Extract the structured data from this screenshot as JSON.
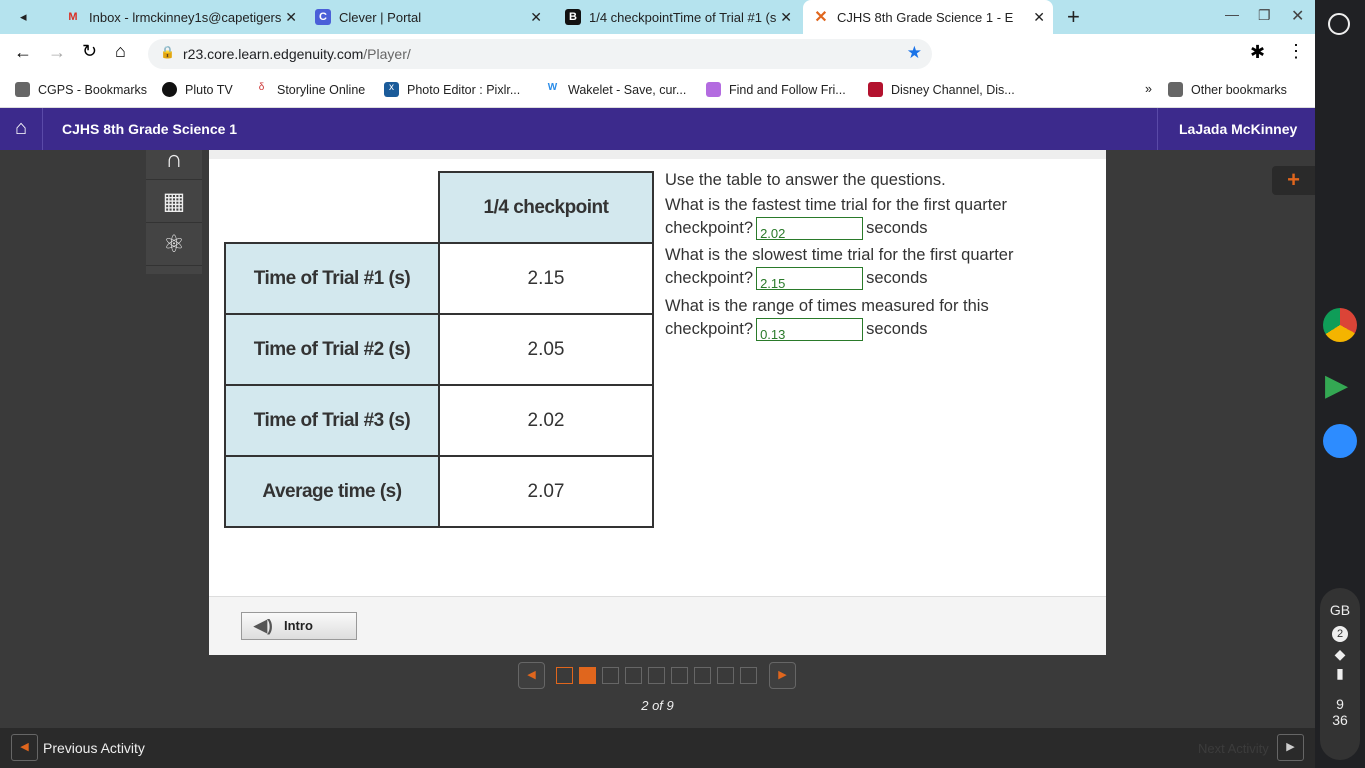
{
  "browser": {
    "tabs": [
      {
        "label": "",
        "icon": "speaker-icon"
      },
      {
        "label": "Inbox - lrmckinney1s@capetigers"
      },
      {
        "label": "Clever | Portal"
      },
      {
        "label": "1/4 checkpointTime of Trial #1 (s"
      },
      {
        "label": "CJHS 8th Grade Science 1 - E"
      }
    ],
    "url_host": "r23.core.learn.edgenuity.com",
    "url_path": "/Player/",
    "bookmarks": [
      "CGPS - Bookmarks",
      "Pluto TV",
      "Storyline Online",
      "Photo Editor : Pixlr...",
      "Wakelet - Save, cur...",
      "Find and Follow Fri...",
      "Disney Channel, Dis..."
    ],
    "other_bookmarks": "Other bookmarks"
  },
  "header": {
    "course": "CJHS 8th Grade Science 1",
    "user": "LaJada McKinney"
  },
  "table": {
    "column_header": "1/4 checkpoint",
    "rows": [
      {
        "label": "Time of Trial #1 (s)",
        "value": "2.15"
      },
      {
        "label": "Time of Trial #2 (s)",
        "value": "2.05"
      },
      {
        "label": "Time of Trial #3 (s)",
        "value": "2.02"
      },
      {
        "label": "Average time (s)",
        "value": "2.07"
      }
    ]
  },
  "questions": {
    "intro": "Use the table to answer the questions.",
    "unit": "seconds",
    "items": [
      {
        "line1": "What is the fastest time trial for the first quarter",
        "line2": "checkpoint?",
        "answer": "2.02"
      },
      {
        "line1": "What is the slowest time trial for the first quarter",
        "line2": "checkpoint?",
        "answer": "2.15"
      },
      {
        "line1": "What is the range of times measured for this",
        "line2": "checkpoint?",
        "answer": "0.13"
      }
    ]
  },
  "intro_button": "Intro",
  "pager": {
    "text": "2 of 9",
    "current": 2,
    "total": 9
  },
  "prev_activity": "Previous Activity",
  "next_activity": "Next Activity",
  "system": {
    "lang": "GB",
    "notif": "2",
    "hour": "9",
    "minute": "36"
  },
  "colors": {
    "header": "#3c2a8c",
    "accent": "#e0661d",
    "answer": "#2a7a2a"
  }
}
